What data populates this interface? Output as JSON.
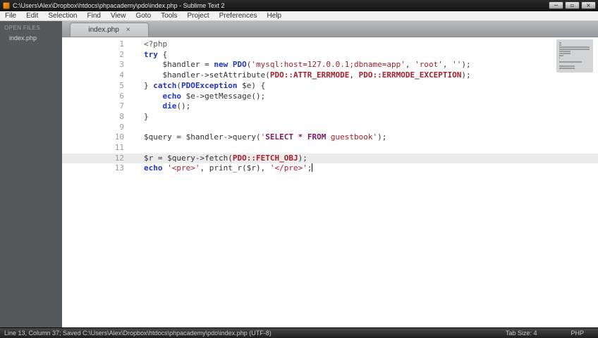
{
  "window": {
    "title": "C:\\Users\\Alex\\Dropbox\\htdocs\\phpacademy\\pdo\\index.php - Sublime Text 2",
    "controls": {
      "minimize": "−",
      "maximize": "▫",
      "close": "×"
    }
  },
  "menu": {
    "items": [
      "File",
      "Edit",
      "Selection",
      "Find",
      "View",
      "Goto",
      "Tools",
      "Project",
      "Preferences",
      "Help"
    ]
  },
  "sidebar": {
    "header": "OPEN FILES",
    "files": [
      "index.php"
    ]
  },
  "tabs": [
    {
      "label": "index.php",
      "close_glyph": "×"
    }
  ],
  "editor": {
    "lines": [
      {
        "n": "1",
        "seg": [
          [
            "tag",
            "<?php"
          ]
        ]
      },
      {
        "n": "2",
        "seg": [
          [
            "kw",
            "try"
          ],
          [
            "pl",
            " {"
          ]
        ]
      },
      {
        "n": "3",
        "seg": [
          [
            "pl",
            "    "
          ],
          [
            "var",
            "$handler"
          ],
          [
            "pl",
            " = "
          ],
          [
            "kw",
            "new"
          ],
          [
            "pl",
            " "
          ],
          [
            "cls",
            "PDO"
          ],
          [
            "pl",
            "("
          ],
          [
            "str",
            "'mysql:host=127.0.0.1;dbname=app'"
          ],
          [
            "pl",
            ", "
          ],
          [
            "str",
            "'root'"
          ],
          [
            "pl",
            ", "
          ],
          [
            "str",
            "''"
          ],
          [
            "pl",
            ");"
          ]
        ]
      },
      {
        "n": "4",
        "seg": [
          [
            "pl",
            "    "
          ],
          [
            "var",
            "$handler"
          ],
          [
            "pl",
            "->setAttribute("
          ],
          [
            "con",
            "PDO::ATTR_ERRMODE"
          ],
          [
            "pl",
            ", "
          ],
          [
            "con",
            "PDO::ERRMODE_EXCEPTION"
          ],
          [
            "pl",
            ");"
          ]
        ]
      },
      {
        "n": "5",
        "seg": [
          [
            "pl",
            "} "
          ],
          [
            "kw",
            "catch"
          ],
          [
            "pl",
            "("
          ],
          [
            "cls",
            "PDOException"
          ],
          [
            "pl",
            " "
          ],
          [
            "var",
            "$e"
          ],
          [
            "pl",
            ") {"
          ]
        ]
      },
      {
        "n": "6",
        "seg": [
          [
            "pl",
            "    "
          ],
          [
            "kw",
            "echo"
          ],
          [
            "pl",
            " "
          ],
          [
            "var",
            "$e"
          ],
          [
            "pl",
            "->getMessage();"
          ]
        ]
      },
      {
        "n": "7",
        "seg": [
          [
            "pl",
            "    "
          ],
          [
            "kw",
            "die"
          ],
          [
            "pl",
            "();"
          ]
        ]
      },
      {
        "n": "8",
        "seg": [
          [
            "pl",
            "}"
          ]
        ]
      },
      {
        "n": "9",
        "seg": []
      },
      {
        "n": "10",
        "seg": [
          [
            "var",
            "$query"
          ],
          [
            "pl",
            " = "
          ],
          [
            "var",
            "$handler"
          ],
          [
            "pl",
            "->query("
          ],
          [
            "str",
            "'"
          ],
          [
            "sql",
            "SELECT * FROM"
          ],
          [
            "str",
            " guestbook'"
          ],
          [
            "pl",
            ");"
          ]
        ]
      },
      {
        "n": "11",
        "seg": []
      },
      {
        "n": "12",
        "hl": true,
        "seg": [
          [
            "var",
            "$r"
          ],
          [
            "pl",
            " = "
          ],
          [
            "var",
            "$query"
          ],
          [
            "pl",
            "->fetch("
          ],
          [
            "con",
            "PDO::FETCH_OBJ"
          ],
          [
            "pl",
            ");"
          ]
        ]
      },
      {
        "n": "13",
        "caret": true,
        "seg": [
          [
            "kw",
            "echo"
          ],
          [
            "pl",
            " "
          ],
          [
            "str",
            "'<pre>'"
          ],
          [
            "pl",
            ", print_r("
          ],
          [
            "var",
            "$r"
          ],
          [
            "pl",
            "), "
          ],
          [
            "str",
            "'</pre>'"
          ],
          [
            "pl",
            ";"
          ]
        ]
      }
    ]
  },
  "status": {
    "left": "Line 13, Column 37; Saved C:\\Users\\Alex\\Dropbox\\htdocs\\phpacademy\\pdo\\index.php (UTF-8)",
    "tab_size": "Tab Size: 4",
    "syntax": "PHP"
  }
}
